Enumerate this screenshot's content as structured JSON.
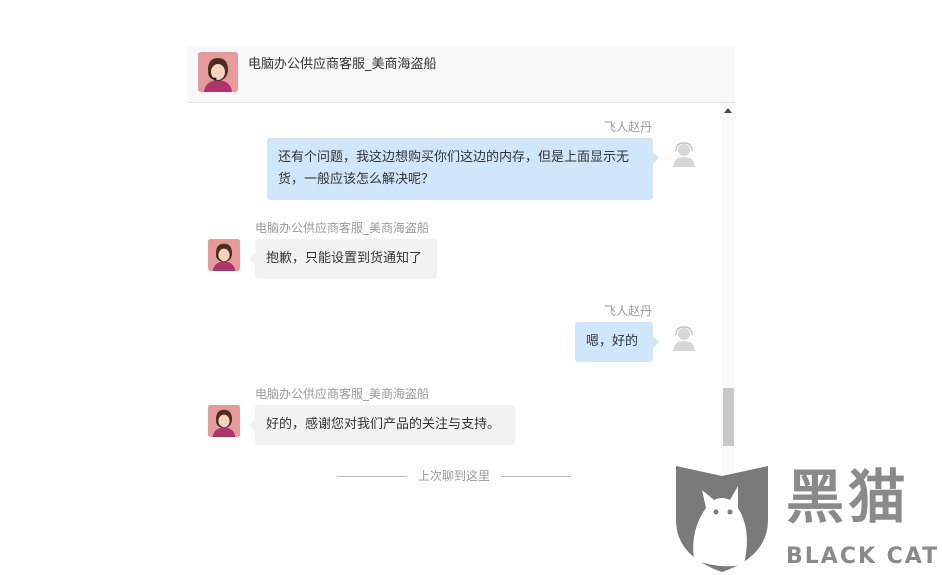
{
  "header": {
    "title": "电脑办公供应商客服_美商海盗船"
  },
  "messages": [
    {
      "sender": "飞人赵丹",
      "direction": "out",
      "text": "还有个问题，我这边想购买你们这边的内存，但是上面显示无货，一般应该怎么解决呢？"
    },
    {
      "sender": "电脑办公供应商客服_美商海盗船",
      "direction": "in",
      "text": "抱歉，只能设置到货通知了"
    },
    {
      "sender": "飞人赵丹",
      "direction": "out",
      "text": "嗯，好的"
    },
    {
      "sender": "电脑办公供应商客服_美商海盗船",
      "direction": "in",
      "text": "好的，感谢您对我们产品的关注与支持。"
    }
  ],
  "history_divider": "上次聊到这里",
  "watermark": {
    "cn": "黑猫",
    "en": "BLACK CAT"
  },
  "colors": {
    "outgoing_bubble": "#cfe6fb",
    "incoming_bubble": "#f2f2f2",
    "header_bg": "#f8f8f8",
    "avatar_bg": "#e79a9a"
  }
}
